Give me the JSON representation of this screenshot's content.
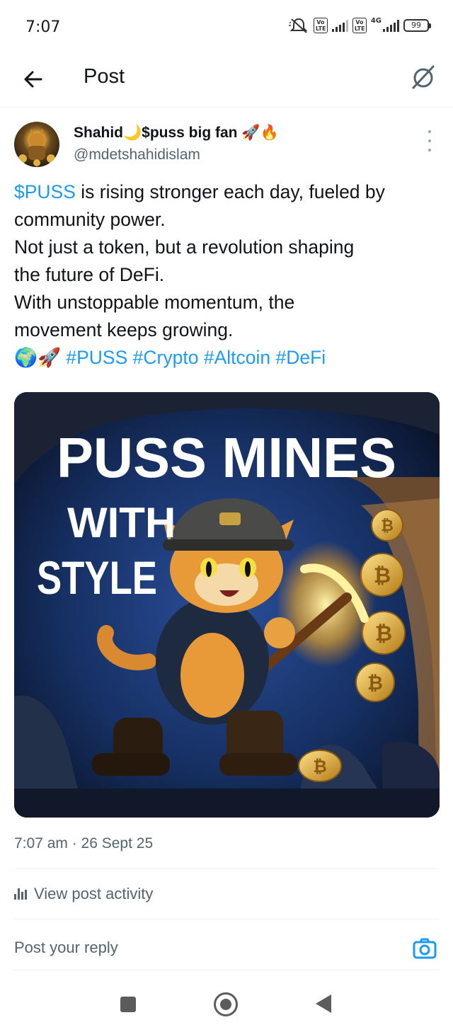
{
  "status_bar": {
    "time": "7:07",
    "volte_1": "Vo LTE",
    "volte_2": "Vo LTE",
    "network": "4G",
    "battery": "99"
  },
  "header": {
    "title": "Post"
  },
  "post": {
    "author": {
      "display_name": "Shahid🌙$puss big fan 🚀🔥",
      "handle": "@mdetshahidislam"
    },
    "text": {
      "cashtag": "$PUSS",
      "line1_rest": " is rising stronger each day, fueled by",
      "line2": "community power.",
      "line3": "Not just a token, but a revolution shaping",
      "line4": "the future of DeFi.",
      "line5": "With unstoppable momentum, the",
      "line6": "movement keeps growing.",
      "emoji": "🌍🚀",
      "hashtags": [
        "#PUSS",
        "#Crypto",
        "#Altcoin",
        "#DeFi"
      ]
    },
    "media": {
      "headline": "PUSS MINES",
      "line2": "WITH",
      "line3": "STYLE",
      "coin_symbol": "₿"
    },
    "timestamp": "7:07 am · 26 Sept 25"
  },
  "actions": {
    "view_activity": "View post activity"
  },
  "reply": {
    "placeholder": "Post your reply"
  },
  "colors": {
    "accent": "#1d9bf0",
    "secondary_text": "#536471"
  }
}
